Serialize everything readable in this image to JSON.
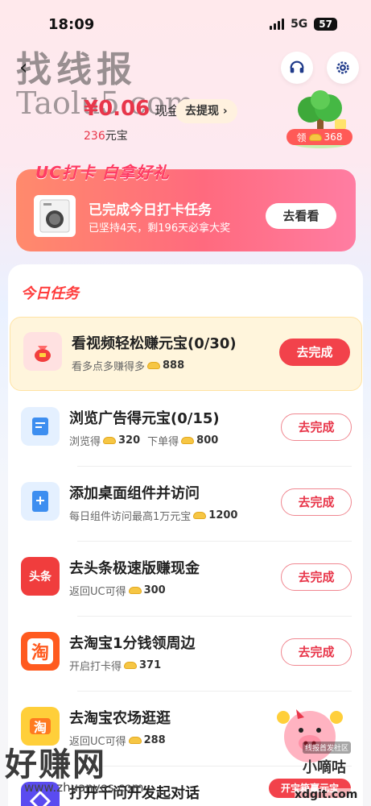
{
  "status_bar": {
    "time": "18:09",
    "network": "5G",
    "battery": "57"
  },
  "header": {
    "watermark": "找线报",
    "watermark_sub": "Taolu5.com",
    "cash_value": "¥0.06",
    "cash_unit": "现金",
    "withdraw_label": "去提现 ›",
    "coins_value": "236",
    "coins_unit": "元宝",
    "tree_badge_prefix": "领",
    "tree_badge_value": "368"
  },
  "banner": {
    "title": "UC打卡 白拿好礼",
    "main_text": "已完成今日打卡任务",
    "sub_text": "已坚持4天，剩196天必拿大奖",
    "button_label": "去看看"
  },
  "tasks_panel": {
    "title": "今日任务",
    "tasks": [
      {
        "title": "看视频轻松赚元宝(0/30)",
        "sub_prefix": "看多点多赚得多",
        "sub_value": "888",
        "sub_mid": "",
        "sub_value2": "",
        "button": "去完成",
        "icon": "red-pouch-icon"
      },
      {
        "title": "浏览广告得元宝(0/15)",
        "sub_prefix": "浏览得",
        "sub_value": "320",
        "sub_mid": "下单得",
        "sub_value2": "800",
        "button": "去完成",
        "icon": "document-icon"
      },
      {
        "title": "添加桌面组件并访问",
        "sub_prefix": "每日组件访问最高1万元宝",
        "sub_value": "1200",
        "sub_mid": "",
        "sub_value2": "",
        "button": "去完成",
        "icon": "tablet-plus-icon"
      },
      {
        "title": "去头条极速版赚现金",
        "sub_prefix": "返回UC可得",
        "sub_value": "300",
        "sub_mid": "",
        "sub_value2": "",
        "button": "去完成",
        "icon": "toutiao-icon",
        "icon_text": "头条"
      },
      {
        "title": "去淘宝1分钱领周边",
        "sub_prefix": "开启打卡得",
        "sub_value": "371",
        "sub_mid": "",
        "sub_value2": "",
        "button": "去完成",
        "icon": "taobao-icon",
        "icon_text": "淘"
      },
      {
        "title": "去淘宝农场逛逛",
        "sub_prefix": "返回UC可得",
        "sub_value": "288",
        "sub_mid": "",
        "sub_value2": "",
        "button": "去完成",
        "icon": "farm-icon",
        "icon_text": "淘"
      },
      {
        "title": "打开千问开发起对话",
        "sub_prefix": "",
        "sub_value": "",
        "sub_mid": "",
        "sub_value2": "",
        "button": "",
        "icon": "qianwen-icon"
      }
    ]
  },
  "overlay": {
    "watermark": "好赚网",
    "watermark_url": "www.zhuanyes.com",
    "pig_caption": "线报首发社区",
    "pig_name": "小嘀咕",
    "pig_banner": "开宝箱赢元宝",
    "site": "xdgit.com"
  },
  "colors": {
    "accent": "#f2424b",
    "highlight_bg": "#fff5dc",
    "cash": "#e8364a"
  }
}
